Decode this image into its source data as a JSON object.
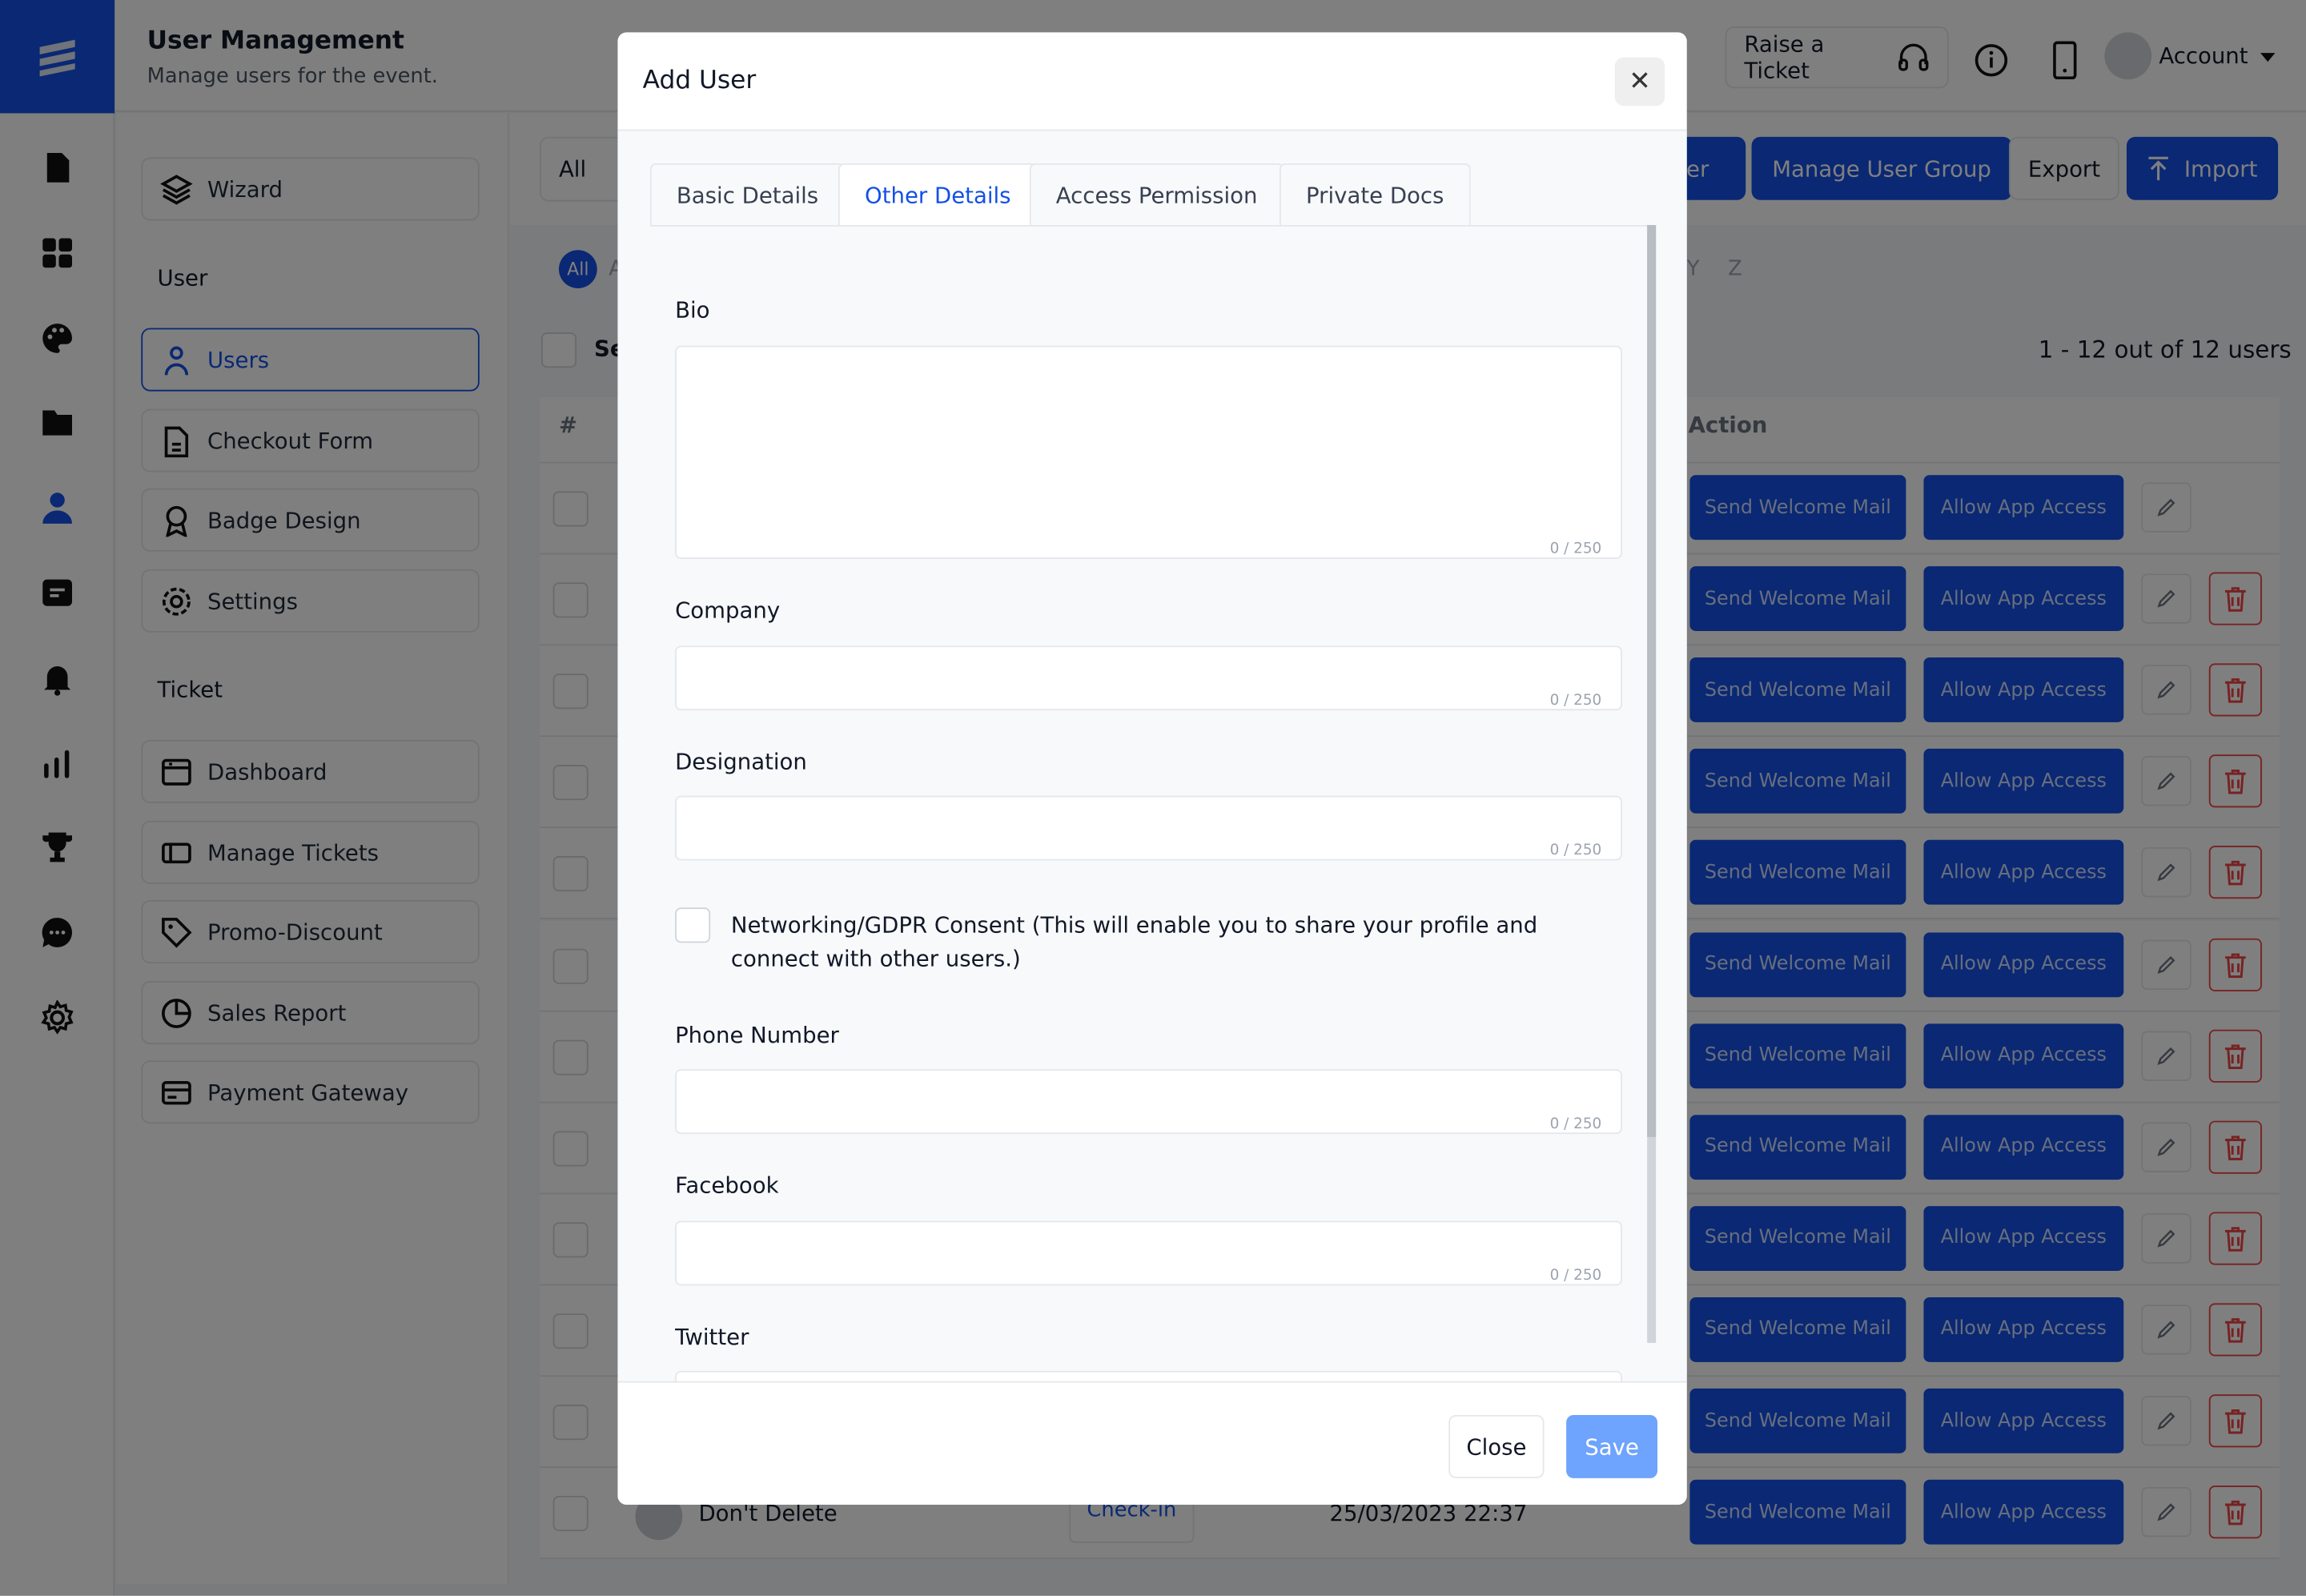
{
  "header": {
    "title": "User Management",
    "subtitle": "Manage users for the event.",
    "raise_ticket": "Raise a Ticket",
    "account": "Account"
  },
  "sidebar": {
    "wizard": "Wizard",
    "section_user": "User",
    "user_items": [
      {
        "label": "Users",
        "icon": "user-icon",
        "active": true
      },
      {
        "label": "Checkout Form",
        "icon": "form-icon"
      },
      {
        "label": "Badge Design",
        "icon": "badge-icon"
      },
      {
        "label": "Settings",
        "icon": "gear-icon"
      }
    ],
    "section_ticket": "Ticket",
    "ticket_items": [
      {
        "label": "Dashboard",
        "icon": "dashboard-icon"
      },
      {
        "label": "Manage Tickets",
        "icon": "ticket-icon"
      },
      {
        "label": "Promo-Discount",
        "icon": "tag-icon"
      },
      {
        "label": "Sales Report",
        "icon": "pie-chart-icon"
      },
      {
        "label": "Payment Gateway",
        "icon": "card-icon"
      }
    ]
  },
  "rail_icons": [
    "document-icon",
    "grid-icon",
    "palette-icon",
    "folder-icon",
    "user-icon",
    "message-icon",
    "bell-icon",
    "bar-chart-icon",
    "trophy-icon",
    "chat-icon",
    "gear-icon"
  ],
  "toolbar": {
    "filter": "All",
    "add_user": "Add User",
    "manage_group": "Manage User Group",
    "export": "Export",
    "import": "Import"
  },
  "letters": {
    "all": "All",
    "first": "A",
    "y": "Y",
    "z": "Z"
  },
  "table": {
    "select_label": "Se",
    "hash": "#",
    "action": "Action",
    "pagination": "1 - 12 out of 12 users",
    "send_mail": "Send Welcome Mail",
    "allow_app": "Allow App Access",
    "last_row": {
      "name": "Don't Delete",
      "status": "Check-in",
      "date": "25/03/2023 22:37"
    }
  },
  "colors": {
    "accent": "#1450e6",
    "save_disabled": "#6ea3fe",
    "danger": "#ef4444"
  },
  "modal": {
    "title": "Add User",
    "tabs": [
      {
        "label": "Basic Details"
      },
      {
        "label": "Other Details",
        "active": true
      },
      {
        "label": "Access Permission"
      },
      {
        "label": "Private Docs"
      }
    ],
    "fields": {
      "bio": "Bio",
      "company": "Company",
      "designation": "Designation",
      "phone": "Phone Number",
      "facebook": "Facebook",
      "twitter": "Twitter",
      "counter": "0 / 250"
    },
    "consent": "Networking/GDPR Consent (This will enable you to share your profile and connect with other users.)",
    "close": "Close",
    "save": "Save"
  }
}
